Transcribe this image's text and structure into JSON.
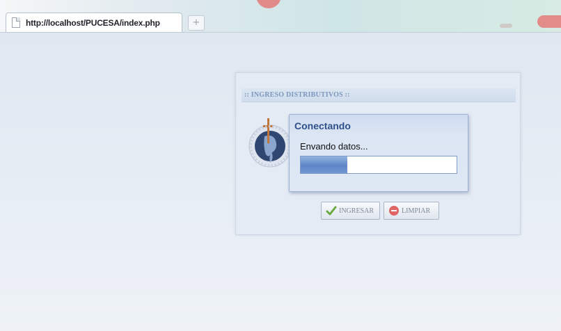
{
  "browser": {
    "tab_title": "http://localhost/PUCESA/index.php",
    "new_tab_symbol": "+",
    "tab_icon": "page-icon"
  },
  "panel": {
    "header": ":: INGRESO DISTRIBUTIVOS ::"
  },
  "dialog": {
    "title": "Conectando",
    "message": "Envando datos...",
    "progress": 0.3
  },
  "buttons": {
    "ingresar": {
      "label": "INGRESAR",
      "icon": "check-icon"
    },
    "limpiar": {
      "label": "LIMPIAR",
      "icon": "clear-icon"
    }
  },
  "colors": {
    "dialog_title": "#2f4f8a",
    "progress": "#5d86c6",
    "header_text": "#7b97bd"
  }
}
